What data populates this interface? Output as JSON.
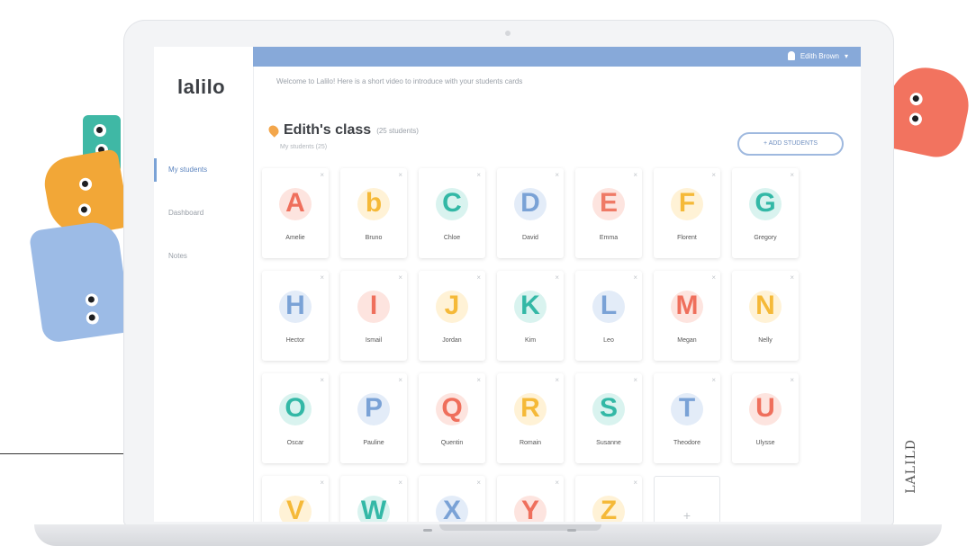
{
  "app": {
    "logo": "lalilo"
  },
  "sidebar": {
    "items": [
      {
        "label": "My students",
        "active": true
      },
      {
        "label": "Dashboard",
        "active": false
      },
      {
        "label": "Notes",
        "active": false
      }
    ]
  },
  "topbar": {
    "user_name": "Edith Brown",
    "welcome": "Welcome to Lalilo! Here is a short video to introduce with your students cards"
  },
  "class": {
    "title": "Edith's class",
    "count": "(25 students)",
    "breadcrumb": "My students (25)"
  },
  "actions": {
    "add_button": "+ ADD STUDENTS"
  },
  "students": [
    {
      "letter": "A",
      "name": "Amelie",
      "color": "#ef6f5c",
      "bg": "#fde4df"
    },
    {
      "letter": "b",
      "name": "Bruno",
      "color": "#f5b938",
      "bg": "#fff2d6"
    },
    {
      "letter": "C",
      "name": "Chloe",
      "color": "#33b8a6",
      "bg": "#d9f3ef"
    },
    {
      "letter": "D",
      "name": "David",
      "color": "#7aa2d6",
      "bg": "#e3ecf8"
    },
    {
      "letter": "E",
      "name": "Emma",
      "color": "#ef7a66",
      "bg": "#fde4df"
    },
    {
      "letter": "F",
      "name": "Florent",
      "color": "#f5b938",
      "bg": "#fff2d6"
    },
    {
      "letter": "G",
      "name": "Gregory",
      "color": "#33b8a6",
      "bg": "#d9f3ef"
    },
    {
      "letter": "H",
      "name": "Hector",
      "color": "#7aa2d6",
      "bg": "#e3ecf8"
    },
    {
      "letter": "I",
      "name": "Ismail",
      "color": "#ef6f5c",
      "bg": "#fde4df"
    },
    {
      "letter": "J",
      "name": "Jordan",
      "color": "#f5b938",
      "bg": "#fff2d6"
    },
    {
      "letter": "K",
      "name": "Kim",
      "color": "#33b8a6",
      "bg": "#d9f3ef"
    },
    {
      "letter": "L",
      "name": "Leo",
      "color": "#7aa2d6",
      "bg": "#e3ecf8"
    },
    {
      "letter": "M",
      "name": "Megan",
      "color": "#ef6f5c",
      "bg": "#fde4df"
    },
    {
      "letter": "N",
      "name": "Nelly",
      "color": "#f5b938",
      "bg": "#fff2d6"
    },
    {
      "letter": "O",
      "name": "Oscar",
      "color": "#33b8a6",
      "bg": "#d9f3ef"
    },
    {
      "letter": "P",
      "name": "Pauline",
      "color": "#7aa2d6",
      "bg": "#e3ecf8"
    },
    {
      "letter": "Q",
      "name": "Quentin",
      "color": "#ef6f5c",
      "bg": "#fde4df"
    },
    {
      "letter": "R",
      "name": "Romain",
      "color": "#f5b938",
      "bg": "#fff2d6"
    },
    {
      "letter": "S",
      "name": "Susanne",
      "color": "#33b8a6",
      "bg": "#d9f3ef"
    },
    {
      "letter": "T",
      "name": "Theodore",
      "color": "#7aa2d6",
      "bg": "#e3ecf8"
    },
    {
      "letter": "U",
      "name": "Ulysse",
      "color": "#ef6f5c",
      "bg": "#fde4df"
    },
    {
      "letter": "V",
      "name": "",
      "color": "#f5b938",
      "bg": "#fff2d6"
    },
    {
      "letter": "W",
      "name": "",
      "color": "#33b8a6",
      "bg": "#d9f3ef"
    },
    {
      "letter": "X",
      "name": "",
      "color": "#7aa2d6",
      "bg": "#e3ecf8"
    },
    {
      "letter": "Y",
      "name": "",
      "color": "#ef6f5c",
      "bg": "#fde4df"
    },
    {
      "letter": "Z",
      "name": "",
      "color": "#f5b938",
      "bg": "#fff2d6"
    }
  ],
  "empty_card_label": "+",
  "footer_brand": "LALILD",
  "colors": {
    "accent": "#87a9d9",
    "orange": "#f3a64b",
    "coral": "#f2735f",
    "teal": "#33b8a6",
    "blue": "#9bb8e3"
  }
}
